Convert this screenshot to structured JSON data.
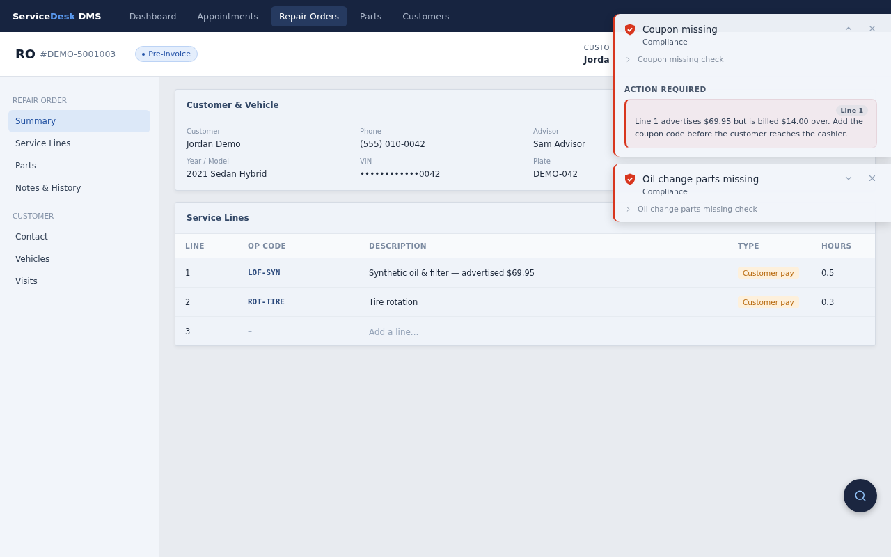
{
  "nav": {
    "brand": [
      {
        "text": "Service",
        "accent": false
      },
      {
        "text": "Desk",
        "accent": true
      },
      {
        "text": " DMS",
        "accent": false
      }
    ],
    "items": [
      {
        "label": "Dashboard",
        "selected": false
      },
      {
        "label": "Appointments",
        "selected": false
      },
      {
        "label": "Repair Orders",
        "selected": true
      },
      {
        "label": "Parts",
        "selected": false
      },
      {
        "label": "Customers",
        "selected": false
      }
    ]
  },
  "header": {
    "prefix": "RO",
    "number": "#DEMO-5001003",
    "status": "Pre-invoice",
    "customer_label": "CUSTO",
    "customer_value": "Jorda"
  },
  "sidebar": {
    "sections": [
      {
        "title": "REPAIR ORDER",
        "items": [
          {
            "label": "Summary",
            "selected": true
          },
          {
            "label": "Service Lines",
            "selected": false
          },
          {
            "label": "Parts",
            "selected": false
          },
          {
            "label": "Notes & History",
            "selected": false
          }
        ]
      },
      {
        "title": "CUSTOMER",
        "items": [
          {
            "label": "Contact",
            "selected": false
          },
          {
            "label": "Vehicles",
            "selected": false
          },
          {
            "label": "Visits",
            "selected": false
          }
        ]
      }
    ]
  },
  "customer_card": {
    "title": "Customer & Vehicle",
    "fields": [
      {
        "label": "Customer",
        "value": "Jordan Demo"
      },
      {
        "label": "Phone",
        "value": "(555) 010-0042"
      },
      {
        "label": "Advisor",
        "value": "Sam Advisor"
      },
      {
        "label": "Year / Model",
        "value": "2021 Sedan Hybrid"
      },
      {
        "label": "VIN",
        "value": "••••••••••••0042"
      },
      {
        "label": "Plate",
        "value": "DEMO-042"
      }
    ]
  },
  "service_lines": {
    "title": "Service Lines",
    "columns": [
      "LINE",
      "OP CODE",
      "DESCRIPTION",
      "TYPE",
      "HOURS"
    ],
    "rows": [
      {
        "kind": "line",
        "line": "1",
        "op_code": "LOF-SYN",
        "description": "Synthetic oil & filter — advertised $69.95",
        "type": "Customer pay",
        "hours": "0.5"
      },
      {
        "kind": "line",
        "line": "2",
        "op_code": "ROT-TIRE",
        "description": "Tire rotation",
        "type": "Customer pay",
        "hours": "0.3"
      },
      {
        "kind": "new",
        "line": "3",
        "op_code": "–",
        "placeholder": "Add a line..."
      }
    ]
  },
  "toasts": [
    {
      "title": "Coupon missing",
      "category": "Compliance",
      "check": "Coupon missing check",
      "expanded": true,
      "action_heading": "ACTION REQUIRED",
      "action_tag": "Line 1",
      "action_text": "Line 1 advertises $69.95 but is billed $14.00 over. Add the coupon code before the customer reaches the cashier."
    },
    {
      "title": "Oil change parts missing",
      "category": "Compliance",
      "check": "Oil change parts missing check",
      "expanded": false
    }
  ]
}
